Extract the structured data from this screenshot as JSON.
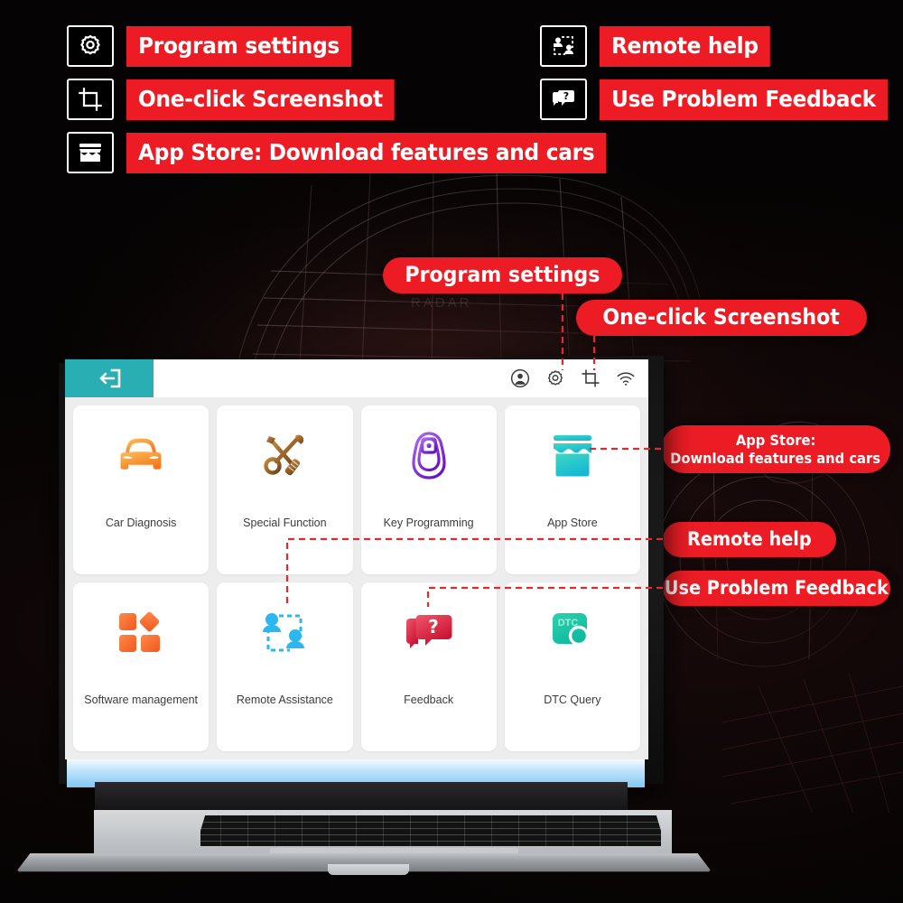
{
  "legend": {
    "items": [
      {
        "icon": "gear-icon",
        "label": "Program settings",
        "col": "left",
        "row": 0
      },
      {
        "icon": "crop-icon",
        "label": "One-click Screenshot",
        "col": "left",
        "row": 1
      },
      {
        "icon": "store-icon",
        "label": "App Store: Download features and cars",
        "col": "left",
        "row": 2
      },
      {
        "icon": "remote-icon",
        "label": "Remote help",
        "col": "right",
        "row": 0
      },
      {
        "icon": "feedback-icon",
        "label": "Use Problem Feedback",
        "col": "right",
        "row": 1
      }
    ]
  },
  "callouts": [
    {
      "name": "callout-program-settings",
      "text": "Program settings"
    },
    {
      "name": "callout-one-click-screenshot",
      "text": "One-click Screenshot"
    },
    {
      "name": "callout-app-store-line1",
      "text": "App Store:"
    },
    {
      "name": "callout-app-store-line2",
      "text": "Download features and cars"
    },
    {
      "name": "callout-remote-help",
      "text": "Remote help"
    },
    {
      "name": "callout-use-problem-feedback",
      "text": "Use Problem Feedback"
    }
  ],
  "app": {
    "topbar": {
      "back_icon": "exit-arrow-icon",
      "back_color": "#29aeb4",
      "tools": [
        {
          "name": "account-icon",
          "label": "Account"
        },
        {
          "name": "gear-icon",
          "label": "Settings"
        },
        {
          "name": "crop-icon",
          "label": "Screenshot"
        },
        {
          "name": "wifi-icon",
          "label": "Wi-Fi"
        }
      ]
    },
    "tiles": [
      {
        "name": "car-diagnosis",
        "label": "Car Diagnosis",
        "icon": "car-icon",
        "color": "#f7941d"
      },
      {
        "name": "special-function",
        "label": "Special Function",
        "icon": "tools-icon",
        "color": "#b4762f"
      },
      {
        "name": "key-programming",
        "label": "Key Programming",
        "icon": "key-fob-icon",
        "color": "#8e2de2"
      },
      {
        "name": "app-store",
        "label": "App Store",
        "icon": "store-icon",
        "color": "#24c6a0"
      },
      {
        "name": "software-management",
        "label": "Software management",
        "icon": "blocks-icon",
        "color": "#f4662a"
      },
      {
        "name": "remote-assistance",
        "label": "Remote Assistance",
        "icon": "remote-icon",
        "color": "#29b6f6"
      },
      {
        "name": "feedback",
        "label": "Feedback",
        "icon": "feedback-icon",
        "color": "#e8374a"
      },
      {
        "name": "dtc-query",
        "label": "DTC Query",
        "icon": "dtc-query-icon",
        "color": "#19c7a4",
        "badge": "DTC"
      }
    ]
  },
  "colors": {
    "accent_red": "#ed1c24",
    "teal": "#29aeb4",
    "background": "#050303"
  }
}
